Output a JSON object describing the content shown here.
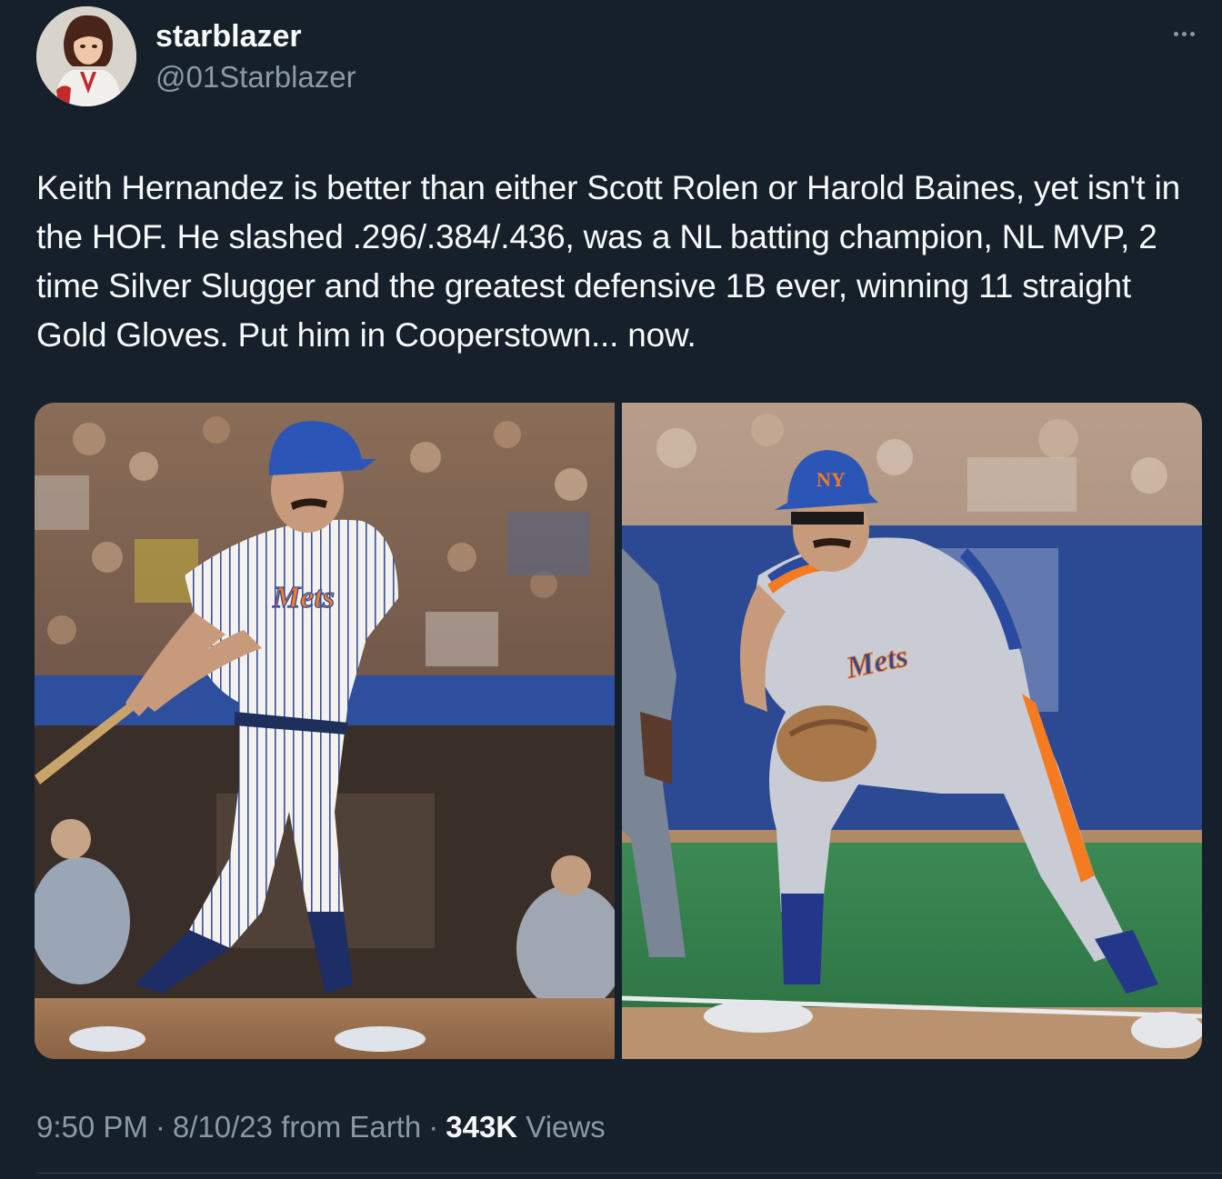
{
  "author": {
    "display_name": "starblazer",
    "handle": "@01Starblazer",
    "avatar_icon": "anime-character-avatar"
  },
  "more_icon": "more-horizontal-icon",
  "tweet": {
    "text": "Keith Hernandez is better than either Scott Rolen or Harold Baines, yet isn't in the HOF. He slashed .296/.384/.436, was a NL batting champion, NL MVP, 2 time Silver Slugger and the greatest defensive 1B ever, winning 11 straight Gold Gloves. Put him in Cooperstown... now."
  },
  "media": {
    "photos": [
      {
        "jersey_text": "Mets"
      },
      {
        "jersey_text": "Mets"
      }
    ]
  },
  "meta": {
    "time": "9:50 PM",
    "date": "8/10/23",
    "source": "from Earth",
    "views_count": "343K",
    "views_label": "Views",
    "separator": "·"
  },
  "colors": {
    "background": "#15202b",
    "text_primary": "#f7f9f9",
    "text_secondary": "#8b98a5",
    "divider": "#38444d"
  }
}
